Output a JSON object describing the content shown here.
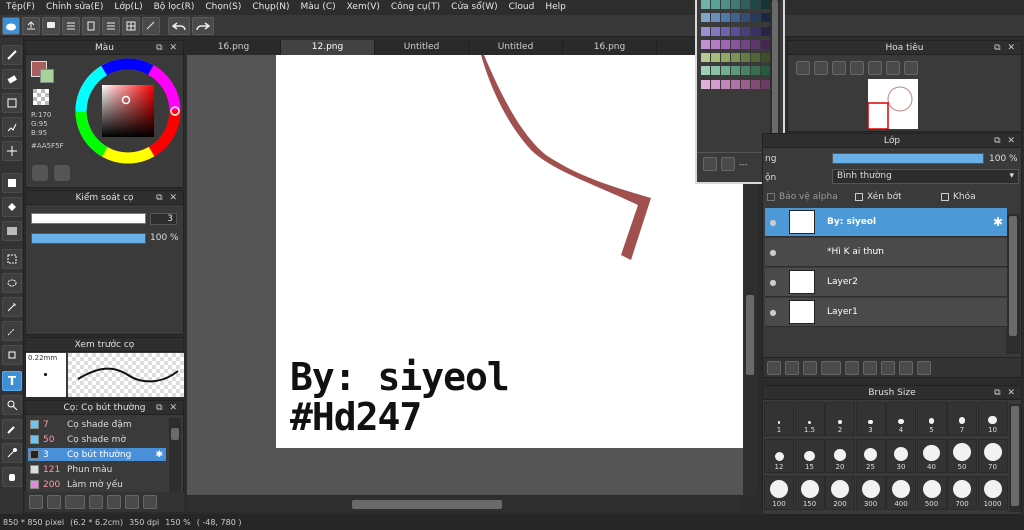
{
  "menu": [
    "Tệp(F)",
    "Chỉnh sửa(E)",
    "Lớp(L)",
    "Bộ lọc(R)",
    "Chọn(S)",
    "Chụp(N)",
    "Màu (C)",
    "Xem(V)",
    "Công cụ(T)",
    "Cửa sổ(W)",
    "Cloud",
    "Help"
  ],
  "tabs": [
    "16.png",
    "12.png",
    "Untitled",
    "Untitled",
    "16.png"
  ],
  "color_panel": {
    "title": "Màu",
    "r": "R:170",
    "g": "G:95",
    "b": "B:95",
    "hex": "#AA5F5F",
    "fg": "#AA5F5F",
    "bg": "#a6d39a"
  },
  "brush_control": {
    "title": "Kiểm soát cọ",
    "size": "3",
    "opacity": "100 %",
    "opacity_fraction": 1.0
  },
  "brush_preview": {
    "title": "Xem trước cọ",
    "size": "0.22mm"
  },
  "brush_list": {
    "title": "Cọ: Cọ bút thường",
    "items": [
      {
        "num": "7",
        "name": "Cọ shade đậm",
        "color": "#6ec6f0"
      },
      {
        "num": "50",
        "name": "Cọ shade mờ",
        "color": "#6ec6f0"
      },
      {
        "num": "3",
        "name": "Cọ bút thường",
        "color": "#222222"
      },
      {
        "num": "121",
        "name": "Phun màu",
        "color": "#dddddd"
      },
      {
        "num": "200",
        "name": "Làm mờ yếu",
        "color": "#e08ad8"
      }
    ]
  },
  "canvas_text": {
    "line1": "By: siyeol",
    "line2": "#Hd247"
  },
  "navigator": {
    "title": "Hoa tiêu"
  },
  "layer_panel": {
    "title": "Lớp",
    "opacity_label": "ng",
    "opacity_value": "100 %",
    "blend_label": "ộn",
    "blend_mode": "Bình thường",
    "protect_alpha": "Bảo vệ alpha",
    "clipping": "Xén bớt",
    "lock": "Khóa",
    "layers": [
      {
        "name": "By: siyeol",
        "selected": true
      },
      {
        "name": "*Hì K ai thưn",
        "selected": false
      },
      {
        "name": "Layer2",
        "selected": false
      },
      {
        "name": "Layer1",
        "selected": false
      }
    ]
  },
  "brush_size": {
    "title": "Brush Size",
    "sizes": [
      "1",
      "1.5",
      "2",
      "3",
      "4",
      "5",
      "7",
      "10",
      "12",
      "15",
      "20",
      "25",
      "30",
      "40",
      "50",
      "70",
      "100",
      "150",
      "200",
      "300",
      "400",
      "500",
      "700",
      "1000"
    ]
  },
  "palette_popup": {
    "label": "---"
  },
  "status": {
    "pixel": "850 * 850 pixel",
    "cm": "(6.2 * 6.2cm)",
    "dpi": "350 dpi",
    "zoom": "150 %",
    "coords": "( -48, 780 )"
  },
  "colors": {
    "accent": "#4a90d9",
    "stroke": "#a0504f"
  }
}
